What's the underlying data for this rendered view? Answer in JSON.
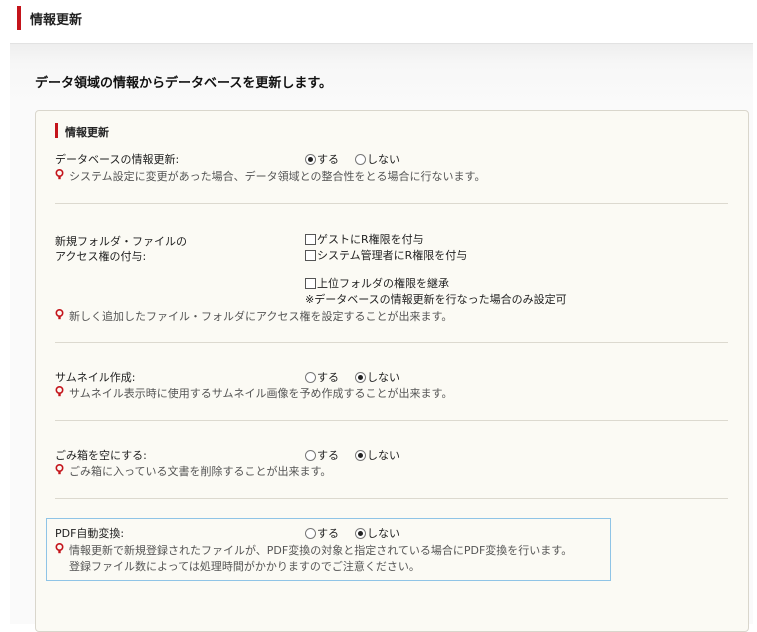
{
  "header": {
    "title": "情報更新"
  },
  "intro": "データ領域の情報からデータベースを更新します。",
  "section_title": "情報更新",
  "icons": {
    "hint": "lightbulb-icon",
    "hint_color": "#c4141b"
  },
  "rows": {
    "db_update": {
      "label": "データベースの情報更新:",
      "options": [
        "する",
        "しない"
      ],
      "selected": "する",
      "hint": "システム設定に変更があった場合、データ領域との整合性をとる場合に行ないます。"
    },
    "access": {
      "label_line1": "新規フォルダ・ファイルの",
      "label_line2": "アクセス権の付与:",
      "check_guest": "ゲストにR権限を付与",
      "check_admin": "システム管理者にR権限を付与",
      "check_inherit": "上位フォルダの権限を継承",
      "note": "※データベースの情報更新を行なった場合のみ設定可",
      "hint": "新しく追加したファイル・フォルダにアクセス権を設定することが出来ます。"
    },
    "thumbnail": {
      "label": "サムネイル作成:",
      "options": [
        "する",
        "しない"
      ],
      "selected": "しない",
      "hint": "サムネイル表示時に使用するサムネイル画像を予め作成することが出来ます。"
    },
    "trash": {
      "label": "ごみ箱を空にする:",
      "options": [
        "する",
        "しない"
      ],
      "selected": "しない",
      "hint": "ごみ箱に入っている文書を削除することが出来ます。"
    },
    "pdf": {
      "label": "PDF自動変換:",
      "options": [
        "する",
        "しない"
      ],
      "selected": "しない",
      "hint_line1": "情報更新で新規登録されたファイルが、PDF変換の対象と指定されている場合にPDF変換を行います。",
      "hint_line2": "登録ファイル数によっては処理時間がかかりますのでご注意ください。"
    }
  },
  "colors": {
    "accent_red": "#c4141b",
    "panel_bg": "#fbfaf4",
    "highlight_border": "#8fc4e6"
  }
}
